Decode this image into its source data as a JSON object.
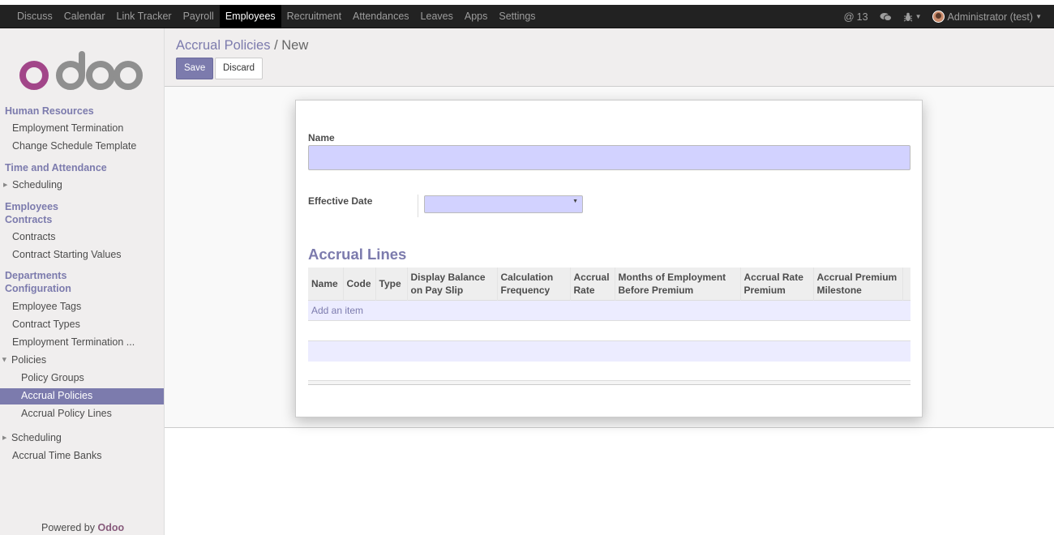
{
  "navbar": {
    "menu": [
      "Discuss",
      "Calendar",
      "Link Tracker",
      "Payroll",
      "Employees",
      "Recruitment",
      "Attendances",
      "Leaves",
      "Apps",
      "Settings"
    ],
    "active": "Employees",
    "mentions_count": "13",
    "user": "Administrator (test)"
  },
  "sidebar": {
    "logo_text": "odoo",
    "sections": {
      "human_resources": "Human Resources",
      "time_attendance": "Time and Attendance",
      "employees": "Employees",
      "contracts": "Contracts",
      "departments": "Departments",
      "configuration": "Configuration"
    },
    "items": {
      "employment_termination": "Employment Termination",
      "change_schedule_template": "Change Schedule Template",
      "scheduling": "Scheduling",
      "contracts": "Contracts",
      "contract_starting_values": "Contract Starting Values",
      "employee_tags": "Employee Tags",
      "contract_types": "Contract Types",
      "employment_termination_trunc": "Employment Termination ...",
      "policies": "Policies",
      "policy_groups": "Policy Groups",
      "accrual_policies": "Accrual Policies",
      "accrual_policy_lines": "Accrual Policy Lines",
      "scheduling2": "Scheduling",
      "accrual_time_banks": "Accrual Time Banks"
    },
    "powered_prefix": "Powered by",
    "powered_brand": "Odoo"
  },
  "control": {
    "breadcrumb_parent": "Accrual Policies",
    "breadcrumb_sep": "/",
    "breadcrumb_current": "New",
    "save_label": "Save",
    "discard_label": "Discard"
  },
  "form": {
    "name_label": "Name",
    "name_value": "",
    "effective_date_label": "Effective Date",
    "effective_date_value": "",
    "accrual_lines_title": "Accrual Lines",
    "columns": [
      "Name",
      "Code",
      "Type",
      "Display Balance on Pay Slip",
      "Calculation Frequency",
      "Accrual Rate",
      "Months of Employment Before Premium",
      "Accrual Rate Premium",
      "Accrual Premium Milestone"
    ],
    "add_item_label": "Add an item"
  },
  "colors": {
    "brand": "#7c7bad",
    "navbar_bg": "#222222",
    "required_field": "#d2d2ff"
  }
}
